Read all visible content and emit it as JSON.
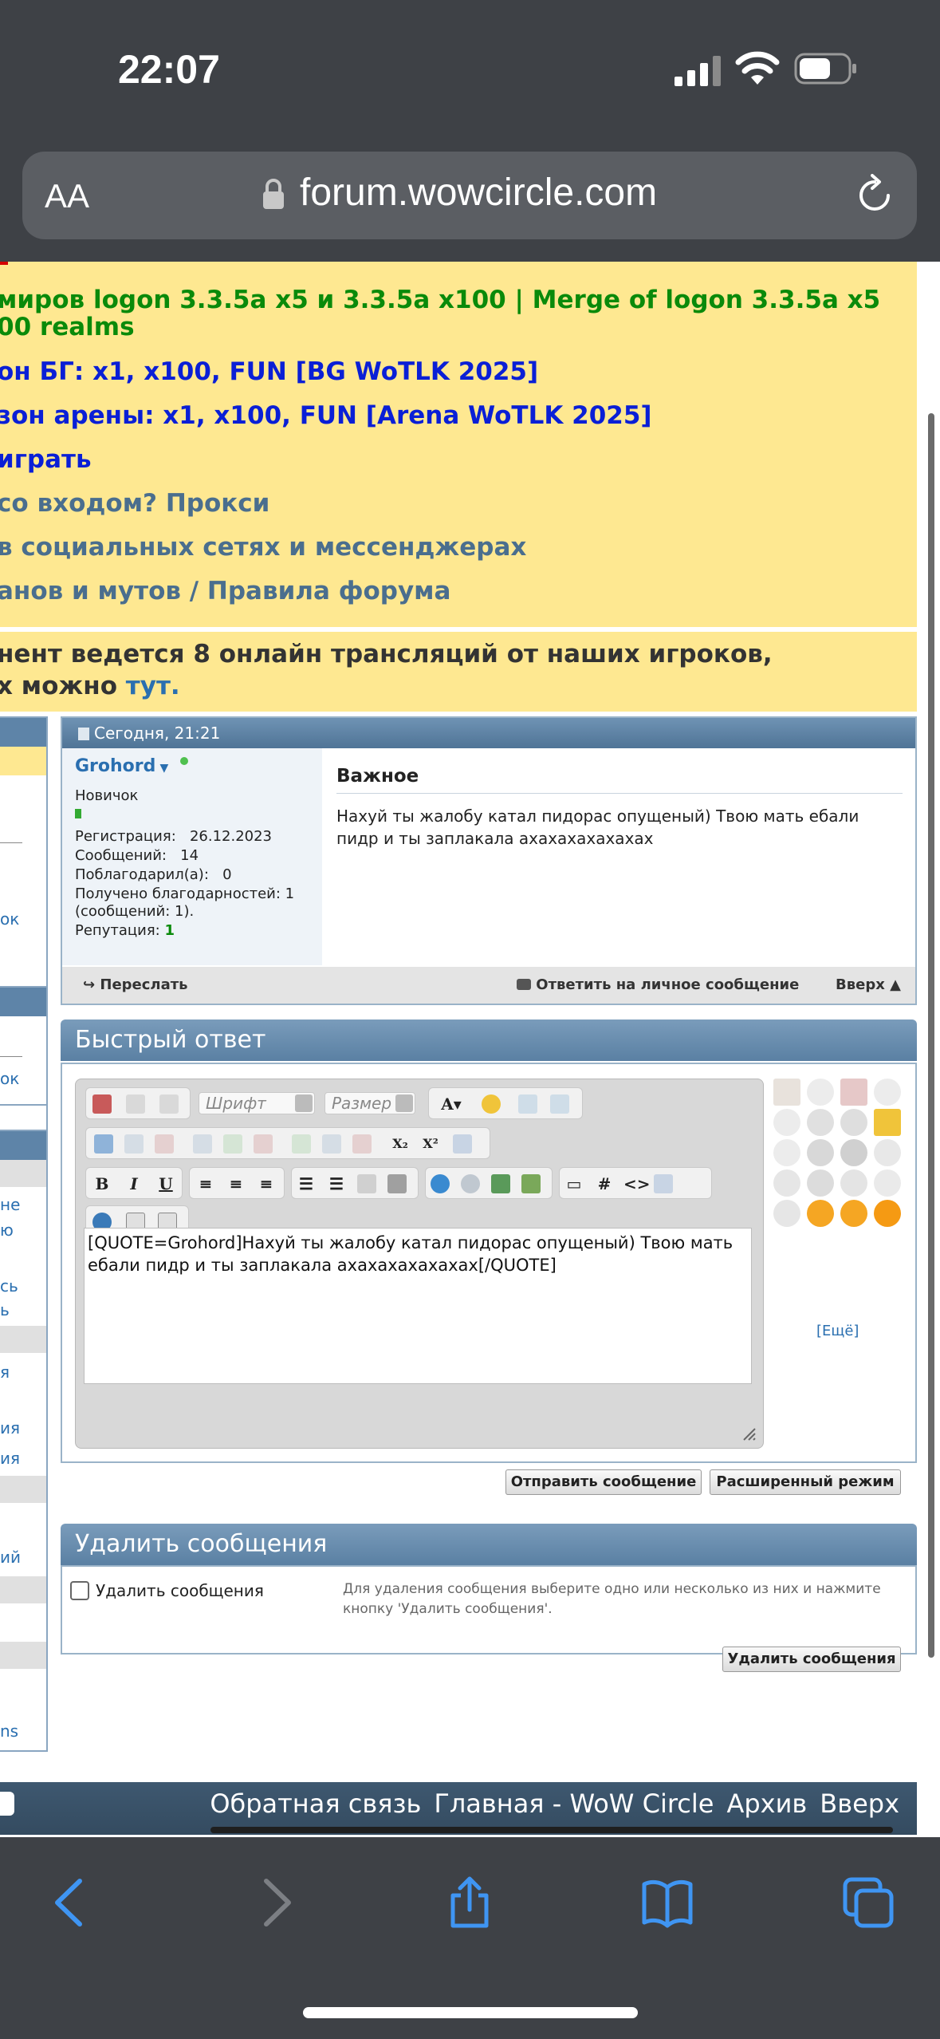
{
  "status_bar": {
    "time": "22:07"
  },
  "browser": {
    "text_size_label": "AA",
    "url": "forum.wowcircle.com"
  },
  "announcements": [
    {
      "text": "миров logon 3.3.5a x5 и 3.3.5a x100 | Merge of logon 3.3.5a x5",
      "color": "green"
    },
    {
      "text": "00 realms",
      "color": "green"
    },
    {
      "text": "он БГ: x1, x100, FUN [BG WoTLK 2025]",
      "color": "blue"
    },
    {
      "text": "зон арены: x1, x100, FUN [Arena WoTLK 2025]",
      "color": "blue"
    },
    {
      "text": "играть",
      "color": "blue"
    },
    {
      "text": "со входом? Прокси",
      "color": "grayblue"
    },
    {
      "text": "в социальных сетях и мессенджерах",
      "color": "grayblue"
    },
    {
      "text": "анов и мутов / Правила форума",
      "color": "grayblue"
    }
  ],
  "stream_notice": {
    "line1": "нент ведется 8 онлайн трансляций от наших игроков,",
    "line2_prefix": "х можно ",
    "line2_link": "тут."
  },
  "sidebar_fragments": [
    "ок",
    "ок",
    "не",
    "ю",
    "сь",
    "ь",
    "я",
    "ия",
    "ия",
    "ий",
    "ns"
  ],
  "post": {
    "date": "Сегодня, 21:21",
    "author": "Grohord",
    "rank": "Новичок",
    "registration_label": "Регистрация:",
    "registration_value": "26.12.2023",
    "messages_label": "Сообщений:",
    "messages_value": "14",
    "thanked_label": "Поблагодарил(а):",
    "thanked_value": "0",
    "received_label": "Получено благодарностей: 1",
    "received_sub": "(сообщений: 1).",
    "reputation_label": "Репутация:",
    "reputation_value": "1",
    "title": "Важное",
    "body": "Нахуй ты жалобу катал пидорас опущеный) Твою мать ебали пидр и ты заплакала ахахахахахахах",
    "forward": "Переслать",
    "reply_pm": "Ответить на личное сообщение",
    "top": "Вверх ▲"
  },
  "quick_reply": {
    "title": "Быстрый ответ",
    "font_placeholder": "Шрифт",
    "size_placeholder": "Размер",
    "text": "[QUOTE=Grohord]Нахуй ты жалобу катал пидорас опущеный) Твою мать ебали пидр и ты заплакала ахахахахахахах[/QUOTE]",
    "more_smilies": "[Ещё]",
    "send_button": "Отправить сообщение",
    "advanced_button": "Расширенный режим"
  },
  "delete_messages": {
    "title": "Удалить сообщения",
    "checkbox_label": "Удалить сообщения",
    "description": "Для удаления сообщения выберите одно или несколько из них и нажмите кнопку 'Удалить сообщения'.",
    "button": "Удалить сообщения"
  },
  "footer": {
    "feedback": "Обратная связь",
    "home": "Главная - WoW Circle",
    "archive": "Архив",
    "top": "Вверх"
  },
  "colors": {
    "notice_bg": "#fee891",
    "panel_header": "#5e84a8",
    "link": "#2a6fb0",
    "chrome": "#3e4146"
  }
}
